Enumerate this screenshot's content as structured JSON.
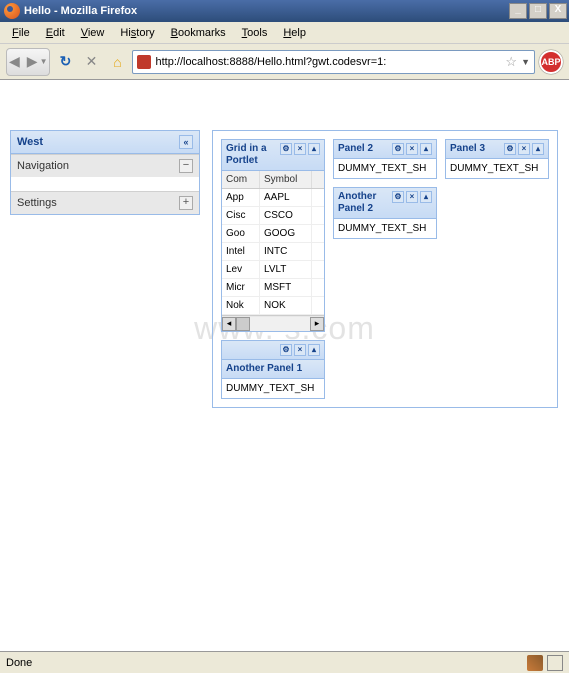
{
  "window": {
    "title": "Hello - Mozilla Firefox",
    "controls": {
      "min": "_",
      "max": "□",
      "close": "X"
    }
  },
  "menu": [
    "File",
    "Edit",
    "View",
    "History",
    "Bookmarks",
    "Tools",
    "Help"
  ],
  "toolbar": {
    "url": "http://localhost:8888/Hello.html?gwt.codesvr=1:",
    "abp": "ABP"
  },
  "watermark": "www.    s.com",
  "west": {
    "title": "West",
    "items": [
      {
        "label": "Navigation",
        "tool": "−",
        "body": ""
      },
      {
        "label": "Settings",
        "tool": "+"
      }
    ]
  },
  "portal": {
    "col1": [
      {
        "title": "Grid in a Portlet",
        "grid": {
          "headers": [
            "Com",
            "Symbol"
          ],
          "rows": [
            [
              "App",
              "AAPL"
            ],
            [
              "Cisc",
              "CSCO"
            ],
            [
              "Goo",
              "GOOG"
            ],
            [
              "Intel",
              "INTC"
            ],
            [
              "Lev",
              "LVLT"
            ],
            [
              "Micr",
              "MSFT"
            ],
            [
              "Nok",
              "NOK"
            ]
          ]
        }
      },
      {
        "title": "Another Panel 1",
        "body": "DUMMY_TEXT_SH"
      }
    ],
    "col2": [
      {
        "title": "Panel 2",
        "body": "DUMMY_TEXT_SH"
      },
      {
        "title": "Another Panel 2",
        "body": "DUMMY_TEXT_SH"
      }
    ],
    "col3": [
      {
        "title": "Panel 3",
        "body": "DUMMY_TEXT_SH"
      }
    ]
  },
  "status": {
    "text": "Done"
  }
}
